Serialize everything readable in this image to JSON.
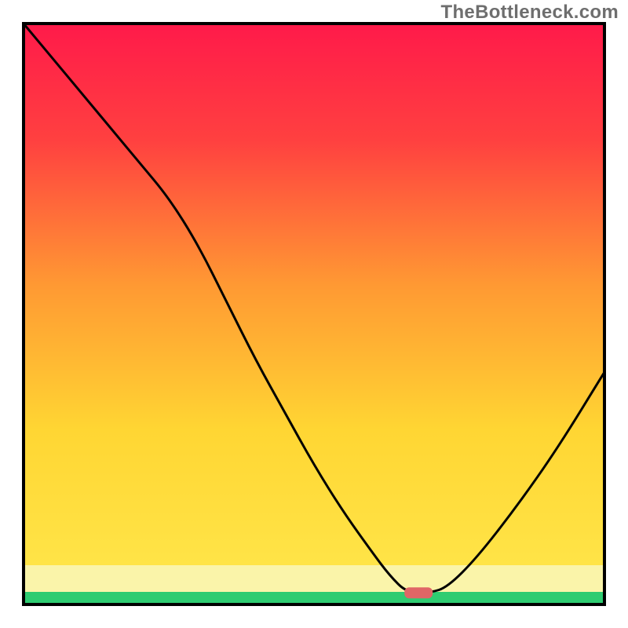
{
  "watermark": "TheBottleneck.com",
  "chart_data": {
    "type": "line",
    "title": "",
    "xlabel": "",
    "ylabel": "",
    "xlim": [
      0,
      100
    ],
    "ylim": [
      0,
      100
    ],
    "grid": false,
    "background_gradient": {
      "top_color": "#ff1a4a",
      "mid_color": "#ffcc33",
      "bottom_band_color": "#f6f27a",
      "green_band_color": "#2ecc71"
    },
    "marker": {
      "x": 68,
      "y": 2,
      "color": "#e06666",
      "label": "optimal-marker"
    },
    "series": [
      {
        "name": "bottleneck-curve",
        "x": [
          0,
          5,
          10,
          15,
          20,
          25,
          30,
          35,
          40,
          45,
          50,
          55,
          60,
          63,
          66,
          70,
          73,
          78,
          85,
          92,
          100
        ],
        "y": [
          100,
          94,
          88,
          82,
          76,
          70,
          62,
          52,
          42,
          33,
          24,
          16,
          9,
          5,
          2,
          2,
          3,
          8,
          17,
          27,
          40
        ]
      }
    ]
  }
}
